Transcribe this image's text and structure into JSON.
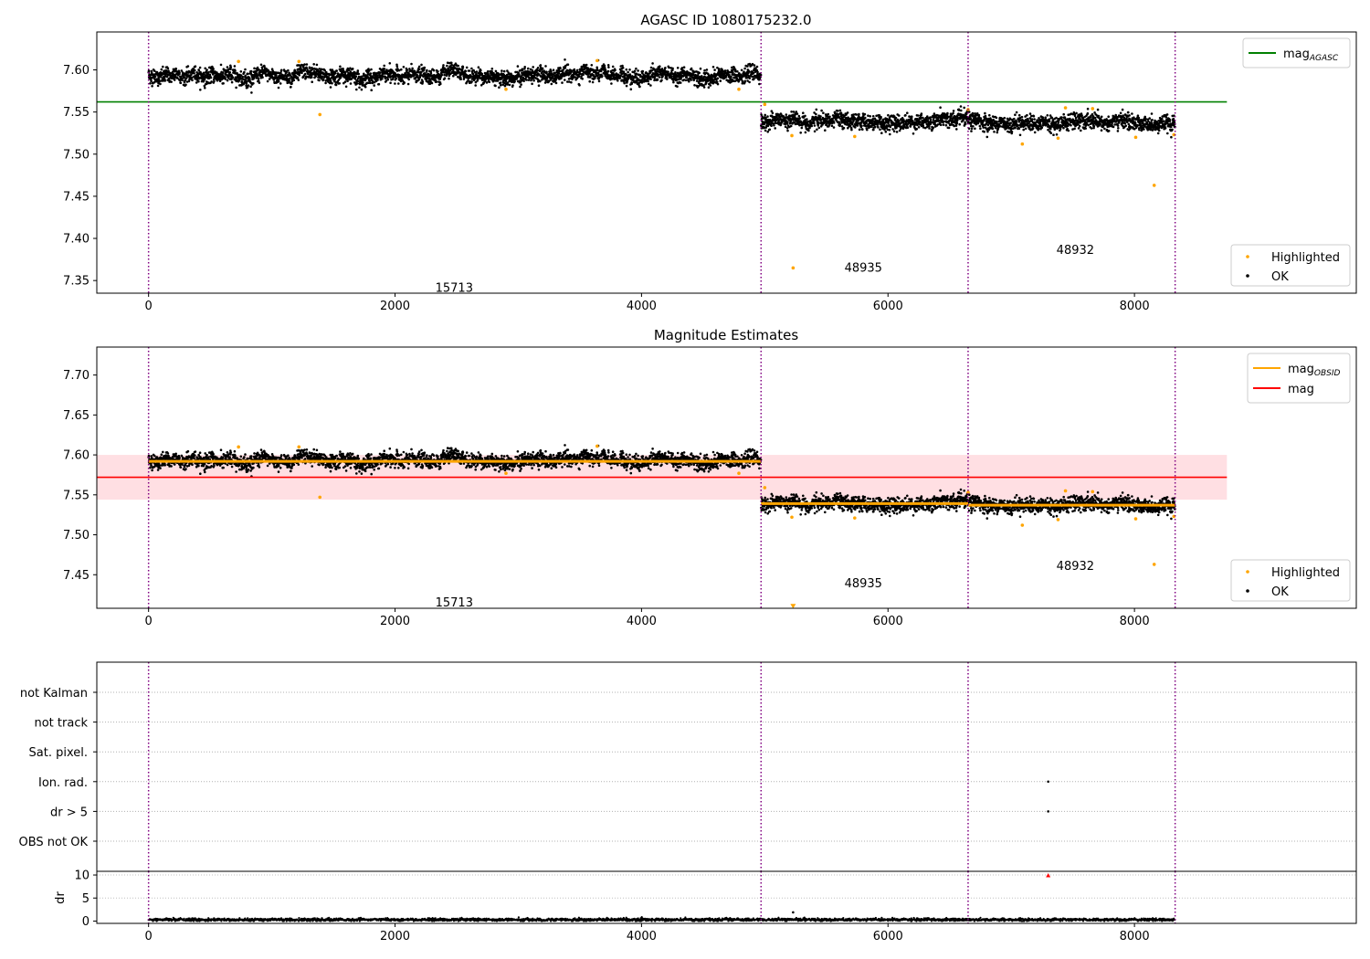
{
  "figure": {
    "title": "AGASC ID 1080175232.0"
  },
  "chart_data": [
    {
      "type": "scatter",
      "title": "AGASC ID 1080175232.0",
      "xlim": [
        -420,
        9800
      ],
      "ylim": [
        7.335,
        7.645
      ],
      "x_ticks": [
        0,
        2000,
        4000,
        6000,
        8000
      ],
      "y_ticks": [
        7.35,
        7.4,
        7.45,
        7.5,
        7.55,
        7.6
      ],
      "obs_boundaries": [
        0,
        4970,
        6650,
        8330
      ],
      "obs_labels": [
        {
          "text": "15713",
          "x": 2480,
          "y": 7.342
        },
        {
          "text": "48935",
          "x": 5800,
          "y": 7.366
        },
        {
          "text": "48932",
          "x": 7520,
          "y": 7.387
        }
      ],
      "reference_lines": [
        {
          "name": "mag",
          "sub": "AGASC",
          "y": 7.562,
          "x_range": [
            -420,
            8750
          ],
          "color": "#008000"
        }
      ],
      "segments": [
        {
          "x_range": [
            0,
            4970
          ],
          "mean": 7.593,
          "sd": 0.0045
        },
        {
          "x_range": [
            4970,
            6650
          ],
          "mean": 7.539,
          "sd": 0.0045
        },
        {
          "x_range": [
            6650,
            8330
          ],
          "mean": 7.538,
          "sd": 0.0045
        }
      ],
      "highlighted_points": [
        {
          "x": 730,
          "y": 7.61
        },
        {
          "x": 1220,
          "y": 7.61
        },
        {
          "x": 1390,
          "y": 7.547
        },
        {
          "x": 2900,
          "y": 7.577
        },
        {
          "x": 3640,
          "y": 7.611
        },
        {
          "x": 4790,
          "y": 7.577
        },
        {
          "x": 5000,
          "y": 7.559
        },
        {
          "x": 5220,
          "y": 7.522
        },
        {
          "x": 5230,
          "y": 7.365
        },
        {
          "x": 5730,
          "y": 7.521
        },
        {
          "x": 6650,
          "y": 7.553
        },
        {
          "x": 7090,
          "y": 7.512
        },
        {
          "x": 7380,
          "y": 7.519
        },
        {
          "x": 7440,
          "y": 7.555
        },
        {
          "x": 7660,
          "y": 7.554
        },
        {
          "x": 8010,
          "y": 7.52
        },
        {
          "x": 8160,
          "y": 7.463
        },
        {
          "x": 8320,
          "y": 7.523
        }
      ],
      "legend": [
        {
          "label": "mag",
          "sub": "AGASC",
          "color": "#008000",
          "marker": "line",
          "position": "top-right"
        }
      ],
      "scatter_legend": [
        {
          "label": "Highlighted",
          "color": "#ffa500"
        },
        {
          "label": "OK",
          "color": "#000000"
        }
      ]
    },
    {
      "type": "scatter",
      "title": "Magnitude Estimates",
      "xlim": [
        -420,
        9800
      ],
      "ylim": [
        7.408,
        7.735
      ],
      "x_ticks": [
        0,
        2000,
        4000,
        6000,
        8000
      ],
      "y_ticks": [
        7.45,
        7.5,
        7.55,
        7.6,
        7.65,
        7.7
      ],
      "obs_boundaries": [
        0,
        4970,
        6650,
        8330
      ],
      "obs_labels": [
        {
          "text": "15713",
          "x": 2480,
          "y": 7.416
        },
        {
          "text": "48935",
          "x": 5800,
          "y": 7.44
        },
        {
          "text": "48932",
          "x": 7520,
          "y": 7.462
        }
      ],
      "band": {
        "y_range": [
          7.544,
          7.6
        ],
        "x_range": [
          -420,
          8750
        ],
        "color": "#ffc0c8"
      },
      "reference_lines": [
        {
          "name": "mag",
          "y": 7.572,
          "x_range": [
            -420,
            8750
          ],
          "color": "#ff0000"
        }
      ],
      "obsid_means": [
        {
          "x_range": [
            0,
            4970
          ],
          "y": 7.592
        },
        {
          "x_range": [
            4970,
            6650
          ],
          "y": 7.539
        },
        {
          "x_range": [
            6650,
            8330
          ],
          "y": 7.537
        }
      ],
      "segments": [
        {
          "x_range": [
            0,
            4970
          ],
          "mean": 7.593,
          "sd": 0.0045
        },
        {
          "x_range": [
            4970,
            6650
          ],
          "mean": 7.539,
          "sd": 0.0045
        },
        {
          "x_range": [
            6650,
            8330
          ],
          "mean": 7.538,
          "sd": 0.0045
        }
      ],
      "highlighted_points": [
        {
          "x": 730,
          "y": 7.61
        },
        {
          "x": 1220,
          "y": 7.61
        },
        {
          "x": 1390,
          "y": 7.547
        },
        {
          "x": 2900,
          "y": 7.577
        },
        {
          "x": 3640,
          "y": 7.611
        },
        {
          "x": 4790,
          "y": 7.577
        },
        {
          "x": 5000,
          "y": 7.559
        },
        {
          "x": 5220,
          "y": 7.522
        },
        {
          "x": 5730,
          "y": 7.521
        },
        {
          "x": 6650,
          "y": 7.553
        },
        {
          "x": 7090,
          "y": 7.512
        },
        {
          "x": 7380,
          "y": 7.519
        },
        {
          "x": 7440,
          "y": 7.555
        },
        {
          "x": 7660,
          "y": 7.554
        },
        {
          "x": 8010,
          "y": 7.52
        },
        {
          "x": 8160,
          "y": 7.463
        },
        {
          "x": 8320,
          "y": 7.523
        }
      ],
      "clipped_points": [
        {
          "x": 5230,
          "y": 7.41,
          "marker": "triangle-down"
        }
      ],
      "legend": [
        {
          "label": "mag",
          "sub": "OBSID",
          "color": "#ffa500",
          "marker": "line",
          "position": "top-right"
        },
        {
          "label": "mag",
          "sub": "",
          "color": "#ff0000",
          "marker": "line",
          "position": "top-right"
        }
      ],
      "scatter_legend": [
        {
          "label": "Highlighted",
          "color": "#ffa500"
        },
        {
          "label": "OK",
          "color": "#000000"
        }
      ]
    },
    {
      "type": "scatter",
      "title": "",
      "xlim": [
        -420,
        9800
      ],
      "x_ticks": [
        0,
        2000,
        4000,
        6000,
        8000
      ],
      "obs_boundaries": [
        0,
        4970,
        6650,
        8330
      ],
      "flag_categories": [
        "not Kalman",
        "not track",
        "Sat. pixel.",
        "Ion. rad.",
        "dr > 5",
        "OBS not OK"
      ],
      "flag_points": [
        {
          "category": "Ion. rad.",
          "x": 7300
        },
        {
          "category": "dr > 5",
          "x": 7300
        }
      ]
    },
    {
      "type": "scatter",
      "title": "",
      "ylabel": "dr",
      "xlim": [
        -420,
        9800
      ],
      "ylim": [
        -0.5,
        10.8
      ],
      "x_ticks": [
        0,
        2000,
        4000,
        6000,
        8000
      ],
      "y_ticks": [
        0,
        5,
        10
      ],
      "obs_boundaries": [
        0,
        4970,
        6650,
        8330
      ],
      "baseline": {
        "x_range": [
          0,
          8330
        ],
        "mean": 0.3,
        "sd": 0.15
      },
      "extra_points": [
        {
          "x": 5230,
          "y": 1.9,
          "color": "#000000"
        },
        {
          "x": 7300,
          "y": 9.9,
          "color": "#ff0000",
          "marker": "triangle-up"
        }
      ]
    }
  ]
}
